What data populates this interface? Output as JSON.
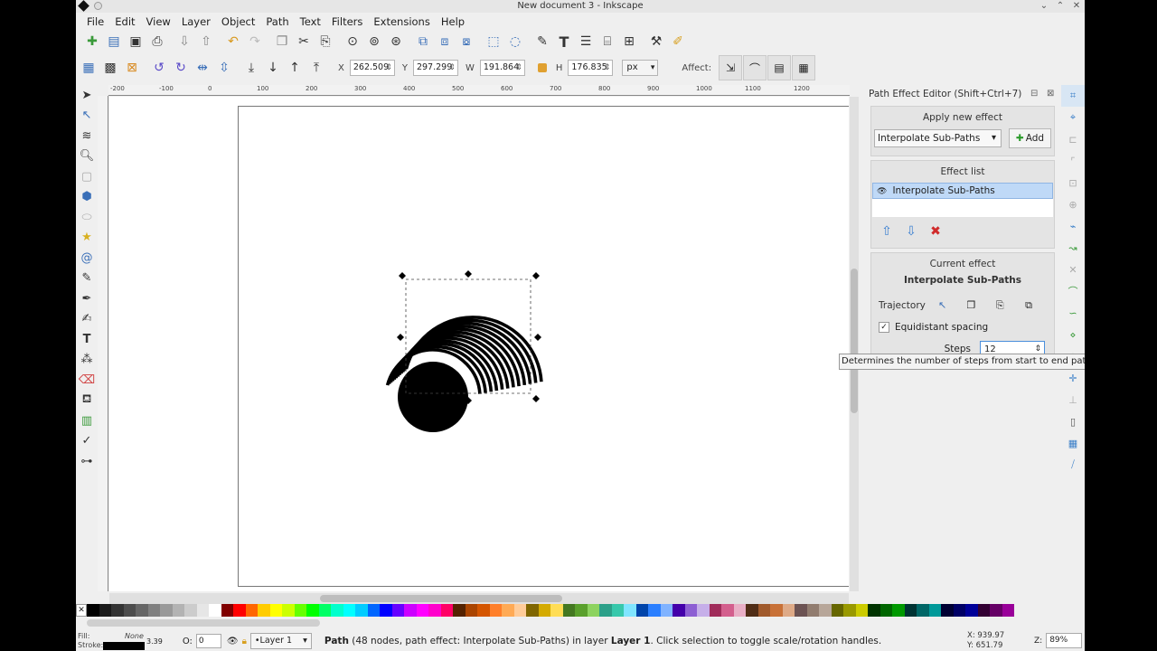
{
  "window": {
    "title": "New document 3 - Inkscape"
  },
  "menu": [
    "File",
    "Edit",
    "View",
    "Layer",
    "Object",
    "Path",
    "Text",
    "Filters",
    "Extensions",
    "Help"
  ],
  "coords": {
    "x_label": "X",
    "x_value": "262.509",
    "y_label": "Y",
    "y_value": "297.299",
    "w_label": "W",
    "w_value": "191.864",
    "h_label": "H",
    "h_value": "176.835",
    "unit": "px",
    "affect_label": "Affect:"
  },
  "ruler_ticks": [
    "-200",
    "-100",
    "0",
    "100",
    "200",
    "300",
    "400",
    "500",
    "600",
    "700",
    "800",
    "900",
    "1000",
    "1100",
    "1200"
  ],
  "panel": {
    "title": "Path Effect Editor (Shift+Ctrl+7)",
    "apply_header": "Apply new effect",
    "selected_effect": "Interpolate Sub-Paths",
    "add_label": "Add",
    "effect_list_header": "Effect list",
    "effect_list": [
      "Interpolate Sub-Paths"
    ],
    "current_header": "Current effect",
    "current_name": "Interpolate Sub-Paths",
    "trajectory_label": "Trajectory",
    "equidistant_label": "Equidistant spacing",
    "equidistant_checked": true,
    "steps_label": "Steps",
    "steps_value": "12"
  },
  "tooltip": "Determines the number of steps from start to end path.",
  "status": {
    "fill_label": "Fill:",
    "stroke_label": "Stroke:",
    "fill_value": "None",
    "stroke_width": "3.39",
    "opacity_label": "O:",
    "opacity_value": "0",
    "layer": "•Layer 1",
    "msg_bold": "Path",
    "msg_rest": " (48 nodes, path effect: Interpolate Sub-Paths) in layer ",
    "msg_layer": "Layer 1",
    "msg_end": ". Click selection to toggle scale/rotation handles.",
    "x": "X: 939.97",
    "y": "Y: 651.79",
    "zoom_label": "Z:",
    "zoom": "89%"
  },
  "palette": [
    "#000000",
    "#1a1a1a",
    "#333333",
    "#4d4d4d",
    "#666666",
    "#808080",
    "#999999",
    "#b3b3b3",
    "#cccccc",
    "#e6e6e6",
    "#ffffff",
    "#800000",
    "#ff0000",
    "#ff6600",
    "#ffcc00",
    "#ffff00",
    "#ccff00",
    "#66ff00",
    "#00ff00",
    "#00ff66",
    "#00ffcc",
    "#00ffff",
    "#00ccff",
    "#0066ff",
    "#0000ff",
    "#6600ff",
    "#cc00ff",
    "#ff00ff",
    "#ff00cc",
    "#ff0066",
    "#552200",
    "#aa4400",
    "#d45500",
    "#ff7f2a",
    "#ffaa55",
    "#ffcc99",
    "#806600",
    "#d4aa00",
    "#ffdd55",
    "#447821",
    "#5aa02c",
    "#8dd35f",
    "#2ca089",
    "#37c8ab",
    "#80e5ff",
    "#0044aa",
    "#2a7fff",
    "#80b3ff",
    "#4400aa",
    "#8d5fd3",
    "#c6afe9",
    "#a02c5a",
    "#d35f8d",
    "#e9afc6",
    "#502d16",
    "#a05a2c",
    "#c87137",
    "#deaa87",
    "#6c5353",
    "#917c6f",
    "#b7a699",
    "#666600",
    "#999900",
    "#cccc00",
    "#003300",
    "#006600",
    "#009900",
    "#003333",
    "#006666",
    "#009999",
    "#000033",
    "#000066",
    "#000099",
    "#330033",
    "#660066",
    "#990099"
  ]
}
